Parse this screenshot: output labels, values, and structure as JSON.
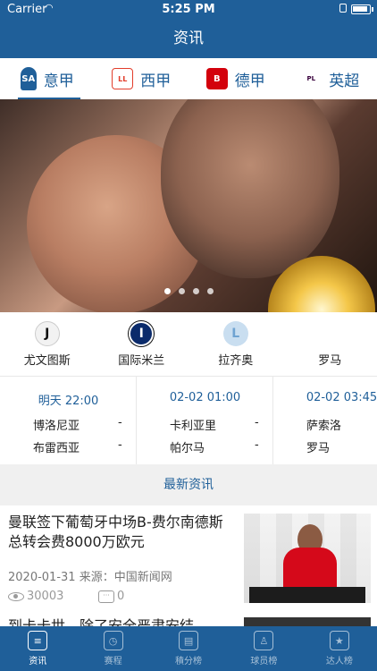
{
  "status": {
    "carrier": "Carrier",
    "time": "5:25 PM"
  },
  "nav": {
    "title": "资讯"
  },
  "tabs": [
    {
      "label": "意甲",
      "logo": "SA"
    },
    {
      "label": "西甲",
      "logo": "LL"
    },
    {
      "label": "德甲",
      "logo": "B"
    },
    {
      "label": "英超",
      "logo": "PL"
    }
  ],
  "banner": {
    "pages": 4,
    "active_page": 0
  },
  "teams": [
    {
      "name": "尤文图斯",
      "logo": "J"
    },
    {
      "name": "国际米兰",
      "logo": "I"
    },
    {
      "name": "拉齐奥",
      "logo": "L"
    },
    {
      "name": "罗马",
      "logo": ""
    }
  ],
  "fixtures": [
    {
      "time": "明天  22:00",
      "home": "博洛尼亚",
      "away": "布雷西亚",
      "score_home": "-",
      "score_away": "-"
    },
    {
      "time": "02-02  01:00",
      "home": "卡利亚里",
      "away": "帕尔马",
      "score_home": "-",
      "score_away": "-"
    },
    {
      "time": "02-02  03:45",
      "home": "萨索洛",
      "away": "罗马",
      "score_home": "",
      "score_away": ""
    }
  ],
  "section": {
    "title": "最新资讯"
  },
  "news": [
    {
      "headline": "曼联签下葡萄牙中场B-费尔南德斯 总转会费8000万欧元",
      "date": "2020-01-31",
      "source": "来源：中国新闻网",
      "views": "30003",
      "comments": "0"
    },
    {
      "headline": "到卡卡世，除了安全严肃安结"
    }
  ],
  "tabbar": [
    {
      "label": "资讯",
      "icon": "news-icon"
    },
    {
      "label": "赛程",
      "icon": "schedule-icon"
    },
    {
      "label": "積分榜",
      "icon": "standings-icon"
    },
    {
      "label": "球员榜",
      "icon": "players-icon"
    },
    {
      "label": "达人榜",
      "icon": "experts-icon"
    }
  ],
  "colors": {
    "primary": "#1f5f99",
    "background": "#f0f0f0",
    "text": "#222222"
  }
}
